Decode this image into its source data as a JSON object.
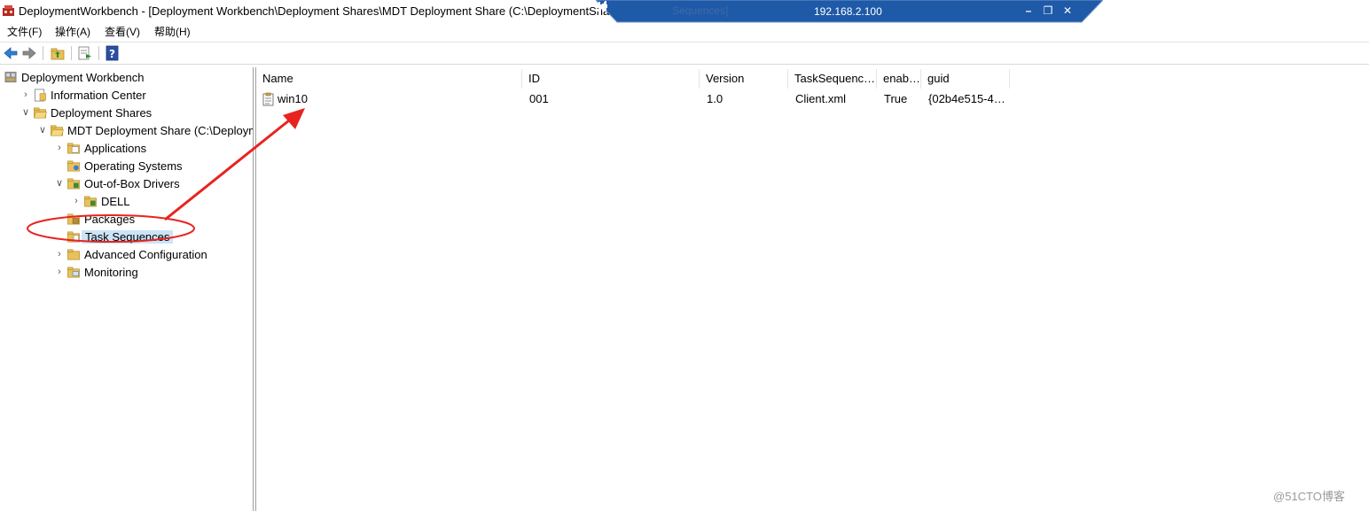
{
  "window": {
    "title": "DeploymentWorkbench - [Deployment Workbench\\Deployment Shares\\MDT Deployment Share (C:\\DeploymentShare)\\Task Sequences]",
    "ghost_text": "Sequences]"
  },
  "remote_bar": {
    "ip": "192.168.2.100",
    "minimize": "–",
    "restore": "❐",
    "close": "✕",
    "colors": {
      "bar": "#1f5aa8",
      "edge": "#6f94c8"
    }
  },
  "menu": [
    {
      "label": "文件(F)"
    },
    {
      "label": "操作(A)"
    },
    {
      "label": "查看(V)"
    },
    {
      "label": "帮助(H)"
    }
  ],
  "toolbar": {
    "icons": [
      "back-arrow-icon",
      "forward-arrow-icon",
      "up-folder-icon",
      "export-list-icon",
      "help-icon"
    ]
  },
  "tree": [
    {
      "label": "Deployment Workbench",
      "level": 0,
      "expander": "",
      "icon": "workbench"
    },
    {
      "label": "Information Center",
      "level": 1,
      "expander": "collapsed",
      "icon": "info"
    },
    {
      "label": "Deployment Shares",
      "level": 1,
      "expander": "expanded",
      "icon": "folder-open"
    },
    {
      "label": "MDT Deployment Share (C:\\DeploymentShare)",
      "level": 2,
      "expander": "expanded",
      "icon": "folder-open"
    },
    {
      "label": "Applications",
      "level": 3,
      "expander": "collapsed",
      "icon": "folder-app"
    },
    {
      "label": "Operating Systems",
      "level": 3,
      "expander": "",
      "icon": "folder-os"
    },
    {
      "label": "Out-of-Box Drivers",
      "level": 3,
      "expander": "expanded",
      "icon": "folder-drivers"
    },
    {
      "label": "DELL",
      "level": 4,
      "expander": "collapsed",
      "icon": "folder-drivers"
    },
    {
      "label": "Packages",
      "level": 3,
      "expander": "",
      "icon": "folder-packages"
    },
    {
      "label": "Task Sequences",
      "level": 3,
      "expander": "",
      "icon": "folder-ts",
      "selected": true
    },
    {
      "label": "Advanced Configuration",
      "level": 3,
      "expander": "collapsed",
      "icon": "folder"
    },
    {
      "label": "Monitoring",
      "level": 3,
      "expander": "collapsed",
      "icon": "folder-monitor"
    }
  ],
  "list": {
    "columns": [
      "Name",
      "ID",
      "Version",
      "TaskSequenc…",
      "enab…",
      "guid"
    ],
    "rows": [
      [
        "win10",
        "001",
        "1.0",
        "Client.xml",
        "True",
        "{02b4e515-4…"
      ]
    ]
  },
  "annotation": {
    "color": "#e8231f"
  },
  "watermark": "@51CTO博客"
}
